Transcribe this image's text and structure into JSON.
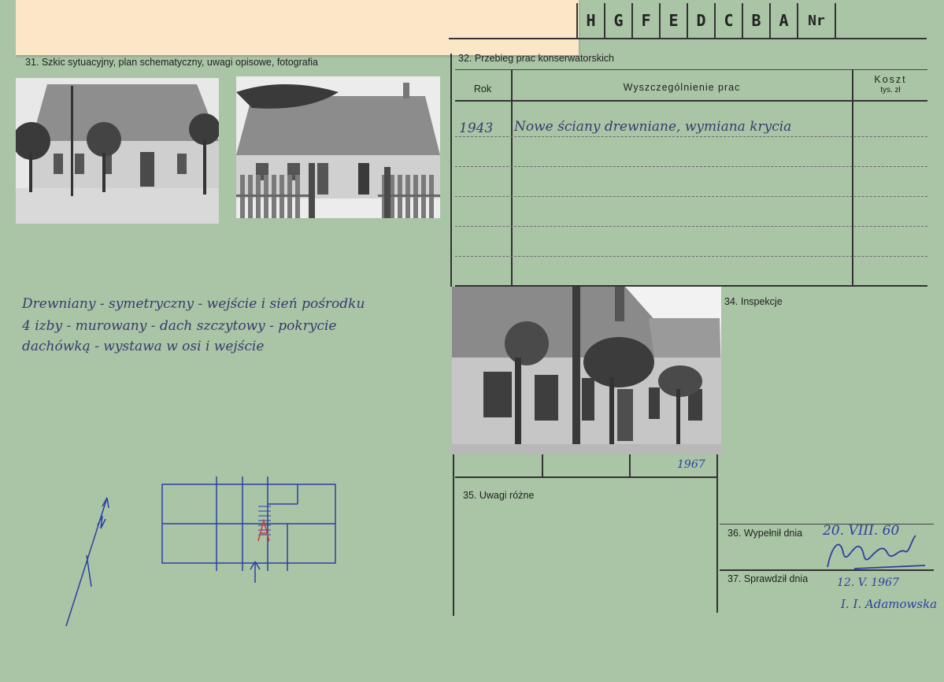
{
  "header": {
    "letters": [
      "H",
      "G",
      "F",
      "E",
      "D",
      "C",
      "B",
      "A",
      "Nr"
    ]
  },
  "section31": {
    "label": "31. Szkic sytuacyjny, plan schematyczny, uwagi opisowe, fotografia",
    "description_lines": [
      "Drewniany - symetryczny - wejście i sień pośrodku",
      "4 izby - murowany - dach szczytowy - pokrycie",
      "dachówką - wystawa w osi i wejście"
    ]
  },
  "section32": {
    "label": "32. Przebieg prac konserwatorskich",
    "col_year": "Rok",
    "col_works": "Wyszczególnienie prac",
    "col_cost": "Koszt",
    "col_cost_unit": "tys. zł",
    "rows": [
      {
        "year": "1943",
        "works": "Nowe ściany drewniane, wymiana krycia"
      }
    ]
  },
  "photo_year": "1967",
  "section34": {
    "label": "34. Inspekcje"
  },
  "section35": {
    "label": "35. Uwagi różne"
  },
  "section36": {
    "label": "36. Wypełnił dnia",
    "date": "20. VIII. 60"
  },
  "section37": {
    "label": "37. Sprawdził dnia",
    "date": "12. V. 1967",
    "signature": "I. I. Adamowska"
  },
  "colors": {
    "card": "#a9c5a5",
    "sticker": "#fbe6c8",
    "ink": "#2d3fa3",
    "pencil": "#3a3a70"
  }
}
